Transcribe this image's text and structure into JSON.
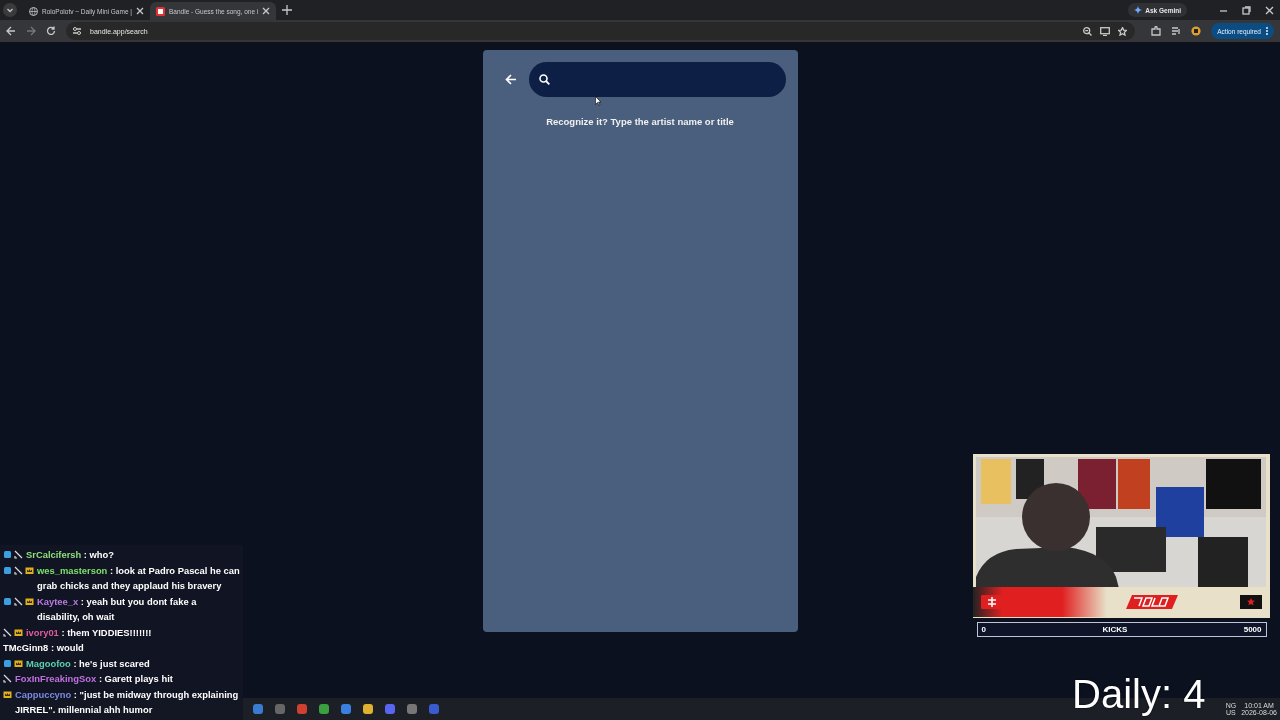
{
  "browser": {
    "tabs": [
      {
        "title": "RoloPolotv ~ Daily Mini Game |",
        "selected": false,
        "kind": "globe"
      },
      {
        "title": "Bandle - Guess the song, one i",
        "selected": true,
        "kind": "bandle"
      }
    ],
    "address": "bandle.app/search",
    "ask_button": "Ask Gemini",
    "action_button": "Action required"
  },
  "page": {
    "hint": "Recognize it? Type the artist name or title"
  },
  "chat": [
    {
      "user": "SrCalcifersh",
      "color": "#8fe07a",
      "gem": true,
      "sword": true,
      "crown": false,
      "message": ": who?"
    },
    {
      "user": "wes_masterson",
      "color": "#7ee06a",
      "gem": true,
      "sword": true,
      "crown": true,
      "message": ": look at Padro Pascal he can grab chicks and they applaud his bravery"
    },
    {
      "user": "Kaytee_x",
      "color": "#b87ae0",
      "gem": true,
      "sword": true,
      "crown": true,
      "message": ": yeah but you dont fake a disability, oh wait"
    },
    {
      "user": "ivory01",
      "color": "#e05aa0",
      "gem": false,
      "sword": true,
      "crown": true,
      "message": ": them YIDDIES!!!!!!!"
    },
    {
      "user": "TMcGinn8",
      "color": "#ffffff",
      "gem": false,
      "sword": false,
      "crown": false,
      "message": ": would"
    },
    {
      "user": "Magoofoo",
      "color": "#5ad0b0",
      "gem": true,
      "sword": false,
      "crown": true,
      "message": ": he's just scared"
    },
    {
      "user": "FoxInFreakingSox",
      "color": "#c070e0",
      "gem": false,
      "sword": true,
      "crown": false,
      "message": ": Garett plays hit"
    },
    {
      "user": "Cappuccyno",
      "color": "#7a8ae0",
      "gem": false,
      "sword": false,
      "crown": true,
      "message": ": \"just be midway through explaining JIRREL\". millennial ahh humor"
    }
  ],
  "webcam": {
    "kind": "picture",
    "meter": {
      "min": "0",
      "label": "KICKS",
      "max": "5000"
    }
  },
  "overlay_text": "Daily: 4",
  "taskbar": {
    "lang": "NG",
    "region": "US",
    "time": "10:01 AM",
    "date": "2026-08-06"
  }
}
